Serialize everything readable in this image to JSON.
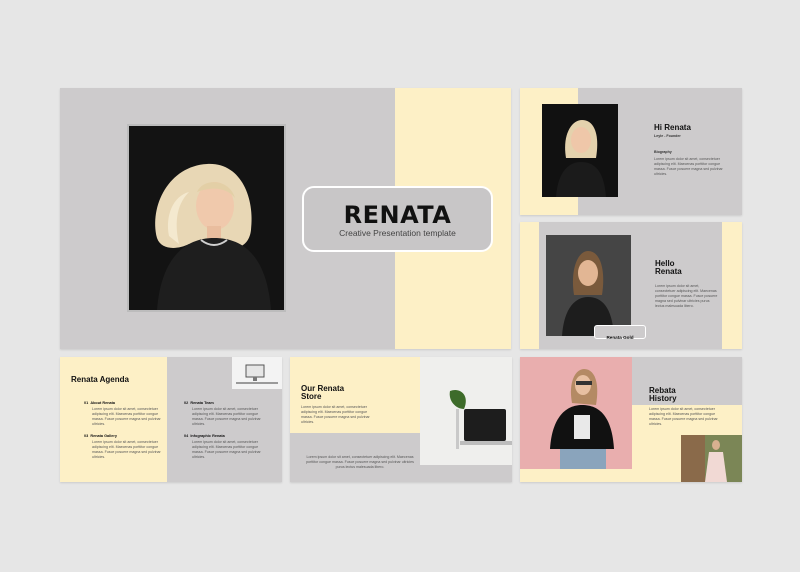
{
  "colors": {
    "background": "#e6e6e6",
    "slide_gray": "#cdcbcc",
    "cream": "#fdf0c6"
  },
  "main": {
    "title": "RENATA",
    "subtitle": "Creative Presentation template"
  },
  "hi_slide": {
    "title": "Hi Renata",
    "role": "Leyle - Founder",
    "section": "Biography",
    "body": "Lorem ipsum dolor sit amet, consectetuer adipiscing elit. Maecenas porttitor congue massa. Fusce posuere magna sed pulvinar ultricies."
  },
  "hello_slide": {
    "title_line1": "Hello",
    "title_line2": "Renata",
    "body": "Lorem ipsum dolor sit amet, consectetuer adipiscing elit. Maecenas porttitor congue massa. Fusce posuere magna sed pulvinar ultricies purus lectus malesuada libero.",
    "badge": "Renata Gold"
  },
  "agenda_slide": {
    "title": "Renata Agenda",
    "items": [
      {
        "num": "01",
        "label": "About Renata",
        "body": "Lorem ipsum dolor sit amet, consectetuer adipiscing elit. Maecenas porttitor congue massa. Fusce posuere magna sed pulvinar ultricies."
      },
      {
        "num": "02",
        "label": "Renata Team",
        "body": "Lorem ipsum dolor sit amet, consectetuer adipiscing elit. Maecenas porttitor congue massa. Fusce posuere magna sed pulvinar ultricies."
      },
      {
        "num": "03",
        "label": "Renata Gallery",
        "body": "Lorem ipsum dolor sit amet, consectetuer adipiscing elit. Maecenas porttitor congue massa. Fusce posuere magna sed pulvinar ultricies."
      },
      {
        "num": "04",
        "label": "Infographic Renata",
        "body": "Lorem ipsum dolor sit amet, consectetuer adipiscing elit. Maecenas porttitor congue massa. Fusce posuere magna sed pulvinar ultricies."
      }
    ]
  },
  "store_slide": {
    "title_line1": "Our Renata",
    "title_line2": "Store",
    "body_top": "Lorem ipsum dolor sit amet, consectetuer adipiscing elit. Maecenas porttitor congue massa. Fusce posuere magna sed pulvinar ultricies.",
    "body_bottom": "Lorem ipsum dolor sit amet, consectetuer adipiscing elit. Maecenas porttitor congue massa. Fusce posuere magna sed pulvinar ultricies purus lectus malesuada libero."
  },
  "history_slide": {
    "title_line1": "Rebata",
    "title_line2": "History",
    "body": "Lorem ipsum dolor sit amet, consectetuer adipiscing elit. Maecenas porttitor congue massa. Fusce posuere magna sed pulvinar ultricies."
  }
}
